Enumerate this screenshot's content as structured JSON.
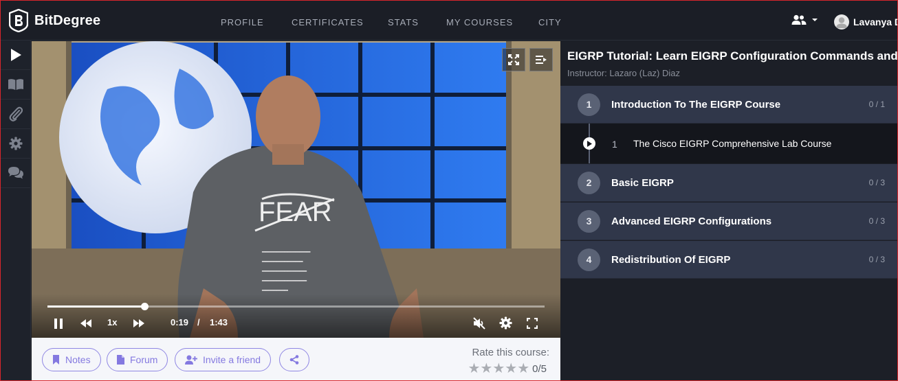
{
  "brand": {
    "name": "BitDegree"
  },
  "nav": {
    "links": [
      "PROFILE",
      "CERTIFICATES",
      "STATS",
      "MY COURSES",
      "CITY"
    ],
    "user_name": "Lavanya D"
  },
  "rail": {
    "icons": [
      "play-icon",
      "book-icon",
      "paperclip-icon",
      "gear-icon",
      "chat-icon"
    ]
  },
  "video": {
    "current_time": "0:19",
    "separator": "/",
    "duration": "1:43",
    "speed": "1x",
    "progress": 0.195
  },
  "actions": {
    "notes": "Notes",
    "forum": "Forum",
    "invite": "Invite a friend"
  },
  "rating": {
    "label": "Rate this course:",
    "value": "0/5",
    "stars": 5
  },
  "course": {
    "title": "EIGRP Tutorial: Learn EIGRP Configuration Commands and More",
    "instructor": "Instructor: Lazaro (Laz) Diaz",
    "sections": [
      {
        "num": "1",
        "title": "Introduction To The EIGRP Course",
        "count": "0 / 1"
      },
      {
        "num": "2",
        "title": "Basic EIGRP",
        "count": "0 / 3"
      },
      {
        "num": "3",
        "title": "Advanced EIGRP Configurations",
        "count": "0 / 3"
      },
      {
        "num": "4",
        "title": "Redistribution Of EIGRP",
        "count": "0 / 3"
      }
    ],
    "active_lesson": {
      "num": "1",
      "title": "The Cisco EIGRP Comprehensive Lab Course"
    }
  },
  "colors": {
    "accent": "#8479e0",
    "topbar": "#1b1e26",
    "section_bg": "#30374a"
  }
}
